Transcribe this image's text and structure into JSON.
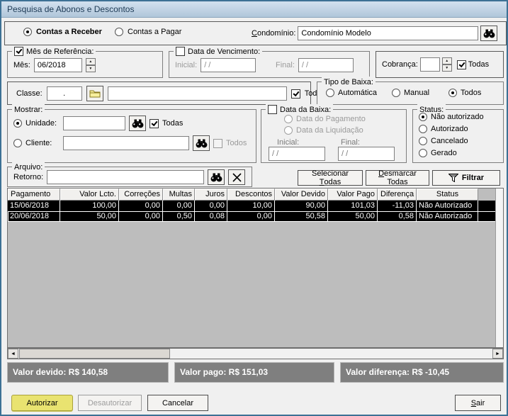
{
  "window": {
    "title": "Pesquisa de Abonos e Descontos"
  },
  "top": {
    "contas_receber": "Contas a Receber",
    "contas_pagar": "Contas a Pagar",
    "condominio_label": {
      "u": "C",
      "post": "ondomínio:"
    },
    "condominio_value": "Condomínio Modelo"
  },
  "mes_ref": {
    "title": "Mês de Referência:",
    "mes_label": "Mês:",
    "mes_value": "06/2018"
  },
  "vencimento": {
    "title": "Data de Vencimento:",
    "inicial_label": "Inicial:",
    "inicial_value": "/ /",
    "final_label": "Final:",
    "final_value": "/ /"
  },
  "cobranca": {
    "label": "Cobrança:",
    "value": "",
    "todas_label": "Todas"
  },
  "classe": {
    "label": "Classe:",
    "code_value": ".",
    "name_value": "",
    "todas_label": "Todas"
  },
  "tipo_baixa": {
    "title": "Tipo de Baixa:",
    "options": [
      "Automática",
      "Manual",
      "Todos"
    ]
  },
  "mostrar": {
    "title": "Mostrar:",
    "unidade_label": "Unidade:",
    "unidade_value": "",
    "todas_label": "Todas",
    "cliente_label": "Cliente:",
    "cliente_value": "",
    "todos_label": "Todos"
  },
  "data_baixa": {
    "title": "Data da Baixa:",
    "opt_pagamento": "Data do Pagamento",
    "opt_liquidacao": "Data da Liquidação",
    "inicial_label": "Inicial:",
    "inicial_value": "/ /",
    "final_label": "Final:",
    "final_value": "/ /"
  },
  "status": {
    "title": "Status:",
    "options": [
      "Não autorizado",
      "Autorizado",
      "Cancelado",
      "Gerado"
    ]
  },
  "arquivo": {
    "title": "Arquivo:",
    "retorno_label": "Retorno:",
    "value": ""
  },
  "actions": {
    "selecionar": {
      "pre": "Selecionar ",
      "u": "T",
      "post": "odas"
    },
    "desmarcar": {
      "u": "D",
      "post": "esmarcar Todas"
    },
    "filtrar": "Filtrar"
  },
  "table": {
    "columns": [
      "Pagamento",
      "Valor Lcto.",
      "Correções",
      "Multas",
      "Juros",
      "Descontos",
      "Valor Devido",
      "Valor Pago",
      "Diferença",
      "Status"
    ],
    "rows": [
      [
        "15/06/2018",
        "100,00",
        "0,00",
        "0,00",
        "0,00",
        "10,00",
        "90,00",
        "101,03",
        "-11,03",
        "Não Autorizado"
      ],
      [
        "20/06/2018",
        "50,00",
        "0,00",
        "0,50",
        "0,08",
        "0,00",
        "50,58",
        "50,00",
        "0,58",
        "Não Autorizado"
      ]
    ]
  },
  "summary": {
    "devido": "Valor devido: R$ 140,58",
    "pago": "Valor pago: R$ 151,03",
    "diferenca": "Valor diferença: R$ -10,45"
  },
  "footer": {
    "autorizar": "Autorizar",
    "desautorizar": "Desautorizar",
    "cancelar": "Cancelar",
    "sair": {
      "u": "S",
      "post": "air"
    }
  },
  "colors": {
    "selected_row_bg": "#000000",
    "highlight_button": "#e9e370",
    "summary_bg": "#7f7f7f"
  }
}
